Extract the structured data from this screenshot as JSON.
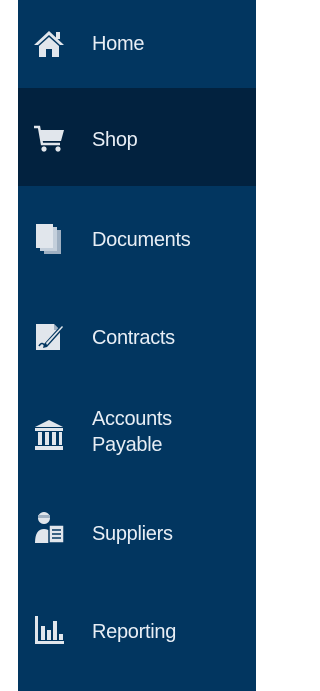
{
  "colors": {
    "sidebar_bg": "#023660",
    "active_bg": "#02223f",
    "text": "#e8eef5",
    "icon": "#e1e6ec"
  },
  "nav": {
    "items": [
      {
        "label": "Home",
        "icon": "home-icon",
        "active": false
      },
      {
        "label": "Shop",
        "icon": "shopping-cart-icon",
        "active": true
      },
      {
        "label": "Documents",
        "icon": "documents-icon",
        "active": false
      },
      {
        "label": "Contracts",
        "icon": "contract-sign-icon",
        "active": false
      },
      {
        "label": "Accounts\nPayable",
        "icon": "bank-icon",
        "active": false
      },
      {
        "label": "Suppliers",
        "icon": "supplier-person-icon",
        "active": false
      },
      {
        "label": "Reporting",
        "icon": "bar-chart-icon",
        "active": false
      }
    ]
  }
}
